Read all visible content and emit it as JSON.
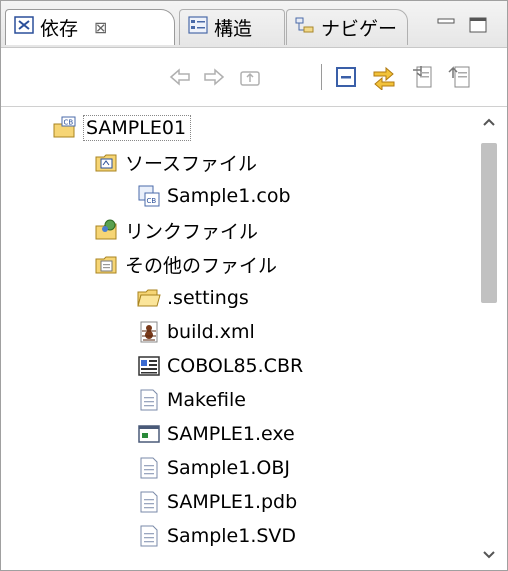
{
  "tabs": [
    {
      "label": "依存",
      "close": "⊠",
      "icon": "dependency-icon"
    },
    {
      "label": "構造",
      "icon": "structure-icon"
    },
    {
      "label": "ナビゲー",
      "icon": "navigator-icon"
    }
  ],
  "window_controls": {
    "minimize": "minimize-icon",
    "maximize": "maximize-icon"
  },
  "toolbar": [
    "back-arrow-icon",
    "forward-arrow-icon",
    "up-folder-icon",
    "collapse-all-icon",
    "link-with-editor-icon",
    "export-icon",
    "import-icon"
  ],
  "tree": {
    "root": {
      "label": "SAMPLE01",
      "icon": "cobol-project-icon"
    },
    "source_files": {
      "label": "ソースファイル",
      "icon": "source-folder-icon"
    },
    "sample_cob": {
      "label": "Sample1.cob",
      "icon": "cobol-source-icon"
    },
    "link_files": {
      "label": "リンクファイル",
      "icon": "link-folder-icon"
    },
    "other_files": {
      "label": "その他のファイル",
      "icon": "other-folder-icon"
    },
    "items": [
      {
        "label": ".settings",
        "icon": "folder-icon"
      },
      {
        "label": "build.xml",
        "icon": "ant-build-icon"
      },
      {
        "label": "COBOL85.CBR",
        "icon": "cbr-file-icon"
      },
      {
        "label": "Makefile",
        "icon": "text-file-icon"
      },
      {
        "label": "SAMPLE1.exe",
        "icon": "executable-icon"
      },
      {
        "label": "Sample1.OBJ",
        "icon": "text-file-icon"
      },
      {
        "label": "SAMPLE1.pdb",
        "icon": "text-file-icon"
      },
      {
        "label": "Sample1.SVD",
        "icon": "text-file-icon"
      }
    ]
  },
  "scrollbar": {
    "up": "scroll-up-icon",
    "down": "scroll-down-icon"
  }
}
